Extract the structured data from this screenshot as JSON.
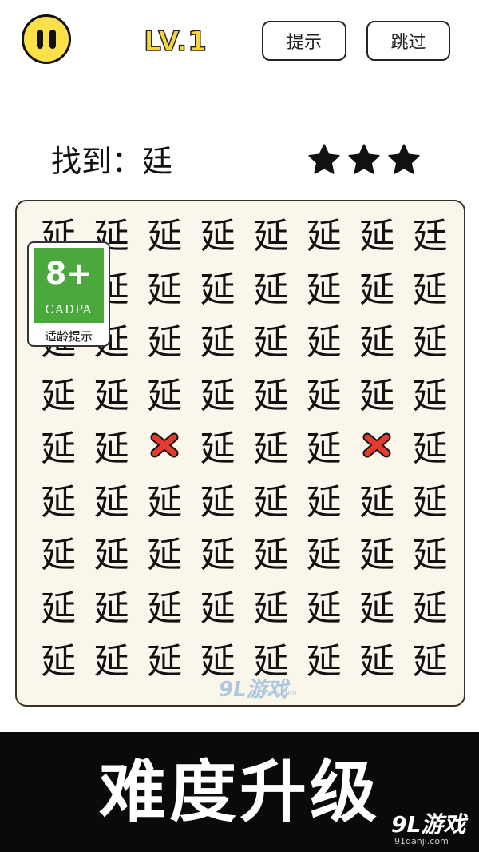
{
  "header": {
    "level": "LV.1",
    "hint_label": "提示",
    "skip_label": "跳过"
  },
  "target": {
    "label": "找到：廷",
    "stars": 3
  },
  "board": {
    "rows": [
      [
        "延",
        "延",
        "延",
        "延",
        "延",
        "延",
        "延",
        "廷"
      ],
      [
        "延",
        "延",
        "延",
        "延",
        "延",
        "延",
        "延",
        "延"
      ],
      [
        "延",
        "延",
        "延",
        "延",
        "延",
        "延",
        "延",
        "延"
      ],
      [
        "延",
        "延",
        "延",
        "延",
        "延",
        "延",
        "延",
        "延"
      ],
      [
        "延",
        "延",
        "",
        "延",
        "延",
        "延",
        "",
        "延"
      ],
      [
        "延",
        "延",
        "延",
        "延",
        "延",
        "延",
        "延",
        "延"
      ],
      [
        "延",
        "延",
        "延",
        "延",
        "延",
        "延",
        "延",
        "延"
      ],
      [
        "延",
        "延",
        "延",
        "延",
        "延",
        "延",
        "延",
        "延"
      ],
      [
        "延",
        "延",
        "延",
        "延",
        "延",
        "延",
        "延",
        "延"
      ]
    ],
    "wrong_marks": [
      [
        4,
        2
      ],
      [
        4,
        6
      ]
    ]
  },
  "age_badge": {
    "rating": "8+",
    "org": "CADPA",
    "tip": "适龄提示"
  },
  "watermark": {
    "brand": "9L游戏",
    "url": "91danji.com"
  },
  "banner": {
    "text": "难度升级"
  },
  "colors": {
    "pause_bg": "#fbe04a",
    "level_text": "#f6d53b",
    "board_bg": "#fbf6ec",
    "cross": "#e53b2e",
    "badge_green": "#4aa83c",
    "banner_bg": "#0a0a0a"
  }
}
